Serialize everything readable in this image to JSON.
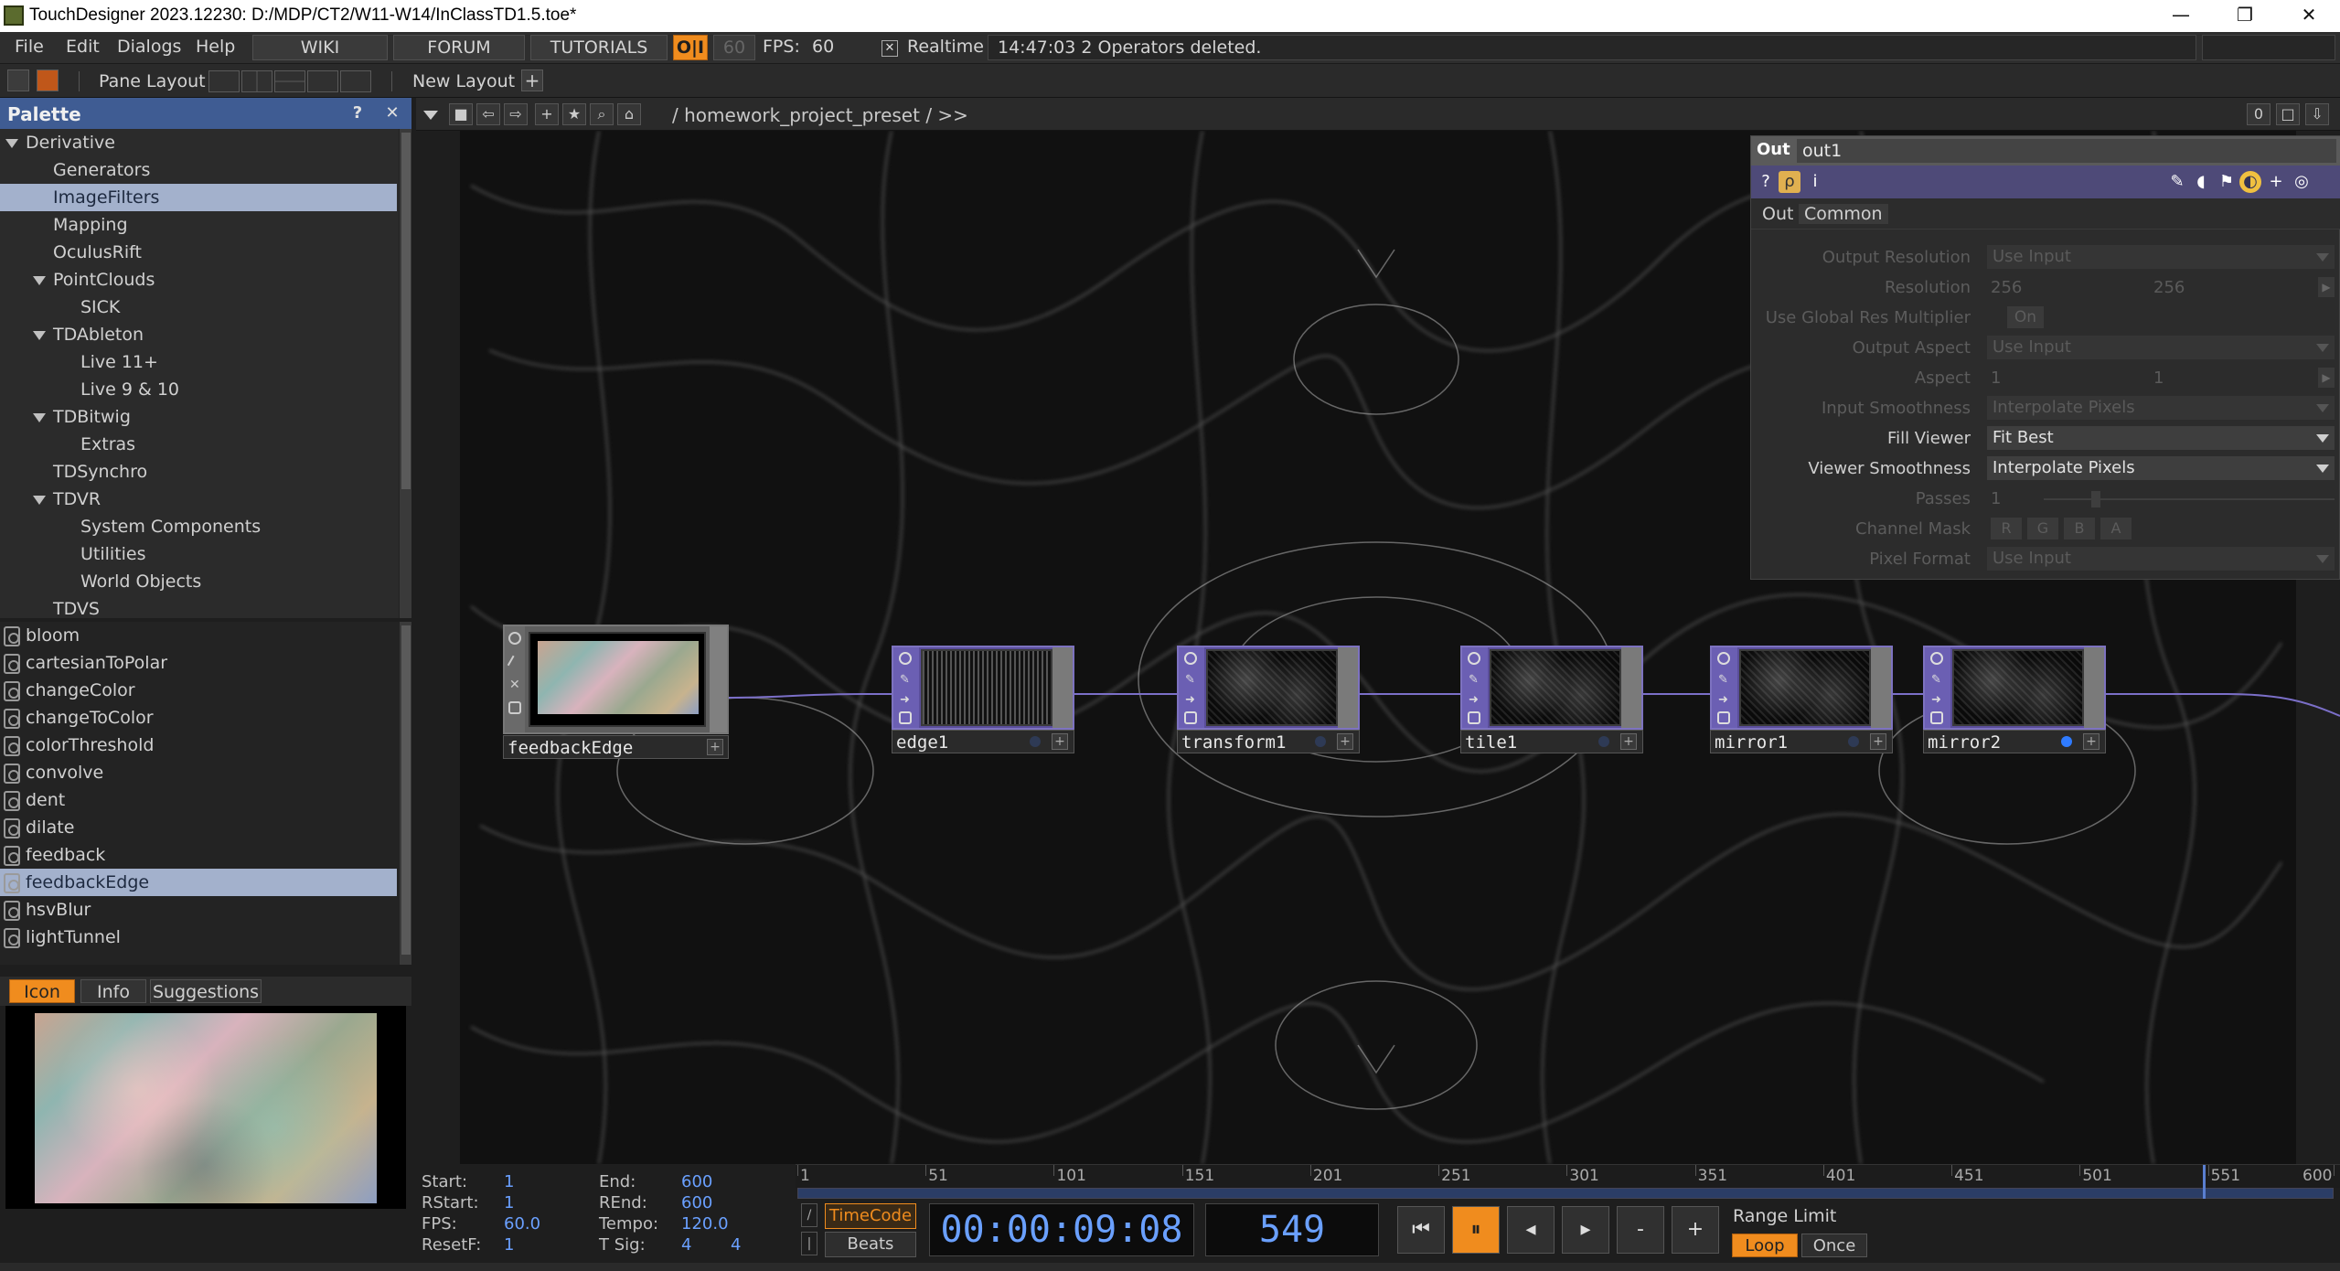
{
  "window": {
    "title": "TouchDesigner 2023.12230: D:/MDP/CT2/W11-W14/InClassTD1.5.toe*",
    "min_glyph": "—",
    "max_glyph": "❐",
    "close_glyph": "✕"
  },
  "menubar": {
    "items": [
      "File",
      "Edit",
      "Dialogs",
      "Help"
    ],
    "wiki": "WIKI",
    "forum": "FORUM",
    "tutorials": "TUTORIALS",
    "perf_badge": "O|I",
    "fps_target": "60",
    "fps_label": "FPS:",
    "fps_value": "60",
    "realtime_check": "✕",
    "realtime_label": "Realtime",
    "status_message": "14:47:03 2 Operators deleted."
  },
  "toolbar2": {
    "pane_layout": "Pane Layout",
    "new_layout": "New Layout",
    "add_glyph": "+"
  },
  "palette": {
    "title": "Palette",
    "help_glyph": "?",
    "close_glyph": "✕",
    "tree": [
      {
        "label": "Derivative",
        "expanded": true,
        "level": 0
      },
      {
        "label": "Generators",
        "level": 1
      },
      {
        "label": "ImageFilters",
        "level": 1,
        "selected": true
      },
      {
        "label": "Mapping",
        "level": 1
      },
      {
        "label": "OculusRift",
        "level": 1
      },
      {
        "label": "PointClouds",
        "expanded": true,
        "level": 1
      },
      {
        "label": "SICK",
        "level": 2
      },
      {
        "label": "TDAbleton",
        "expanded": true,
        "level": 1
      },
      {
        "label": "Live 11+",
        "level": 2
      },
      {
        "label": "Live 9 & 10",
        "level": 2
      },
      {
        "label": "TDBitwig",
        "expanded": true,
        "level": 1
      },
      {
        "label": "Extras",
        "level": 2
      },
      {
        "label": "TDSynchro",
        "level": 1
      },
      {
        "label": "TDVR",
        "expanded": true,
        "level": 1
      },
      {
        "label": "System Components",
        "level": 2
      },
      {
        "label": "Utilities",
        "level": 2
      },
      {
        "label": "World Objects",
        "level": 2
      },
      {
        "label": "TDVS",
        "level": 1
      }
    ],
    "components": [
      {
        "label": "bloom"
      },
      {
        "label": "cartesianToPolar"
      },
      {
        "label": "changeColor"
      },
      {
        "label": "changeToColor"
      },
      {
        "label": "colorThreshold"
      },
      {
        "label": "convolve"
      },
      {
        "label": "dent"
      },
      {
        "label": "dilate"
      },
      {
        "label": "feedback"
      },
      {
        "label": "feedbackEdge",
        "selected": true
      },
      {
        "label": "hsvBlur"
      },
      {
        "label": "lightTunnel"
      }
    ],
    "info_tabs": [
      "Icon",
      "Info",
      "Suggestions"
    ]
  },
  "network": {
    "path": "/ homework_project_preset / >>",
    "zoom_indicator": "0",
    "nodes": [
      "feedbackEdge",
      "edge1",
      "transform1",
      "tile1",
      "mirror1",
      "mirror2"
    ]
  },
  "params": {
    "op_type": "Out",
    "op_name": "out1",
    "tabs": [
      "Out",
      "Common"
    ],
    "rows": {
      "output_resolution": {
        "label": "Output Resolution",
        "value": "Use Input"
      },
      "resolution": {
        "label": "Resolution",
        "w": "256",
        "h": "256"
      },
      "global_res": {
        "label": "Use Global Res Multiplier",
        "value": "On"
      },
      "output_aspect": {
        "label": "Output Aspect",
        "value": "Use Input"
      },
      "aspect": {
        "label": "Aspect",
        "a": "1",
        "b": "1"
      },
      "input_smoothness": {
        "label": "Input Smoothness",
        "value": "Interpolate Pixels"
      },
      "fill_viewer": {
        "label": "Fill Viewer",
        "value": "Fit Best"
      },
      "viewer_smoothness": {
        "label": "Viewer Smoothness",
        "value": "Interpolate Pixels"
      },
      "passes": {
        "label": "Passes",
        "value": "1"
      },
      "channel_mask": {
        "label": "Channel Mask",
        "channels": [
          "R",
          "G",
          "B",
          "A"
        ]
      },
      "pixel_format": {
        "label": "Pixel Format",
        "value": "Use Input"
      }
    }
  },
  "timeline": {
    "ticks": [
      "1",
      "51",
      "101",
      "151",
      "201",
      "251",
      "301",
      "351",
      "401",
      "451",
      "501",
      "551",
      "600"
    ],
    "range_start": 1,
    "range_end": 600,
    "current_frame_value": 549
  },
  "time_info": {
    "start_label": "Start:",
    "start": "1",
    "end_label": "End:",
    "end": "600",
    "rstart_label": "RStart:",
    "rstart": "1",
    "rend_label": "REnd:",
    "rend": "600",
    "fps_label": "FPS:",
    "fps": "60.0",
    "tempo_label": "Tempo:",
    "tempo": "120.0",
    "resetf_label": "ResetF:",
    "resetf": "1",
    "tsig_label": "T Sig:",
    "tsig_a": "4",
    "tsig_b": "4"
  },
  "transport": {
    "timecode_label": "TimeCode",
    "beats_label": "Beats",
    "timecode": "00:00:09:08",
    "frame": "549",
    "minus": "-",
    "plus": "+",
    "range_limit": "Range Limit",
    "loop": "Loop",
    "once": "Once"
  },
  "colors": {
    "accent_orange": "#f08c1e",
    "palette_header": "#3f5c93",
    "selection": "#a3b1cc",
    "node_purple": "#5a4e9a",
    "value_blue": "#6aa0ff"
  }
}
